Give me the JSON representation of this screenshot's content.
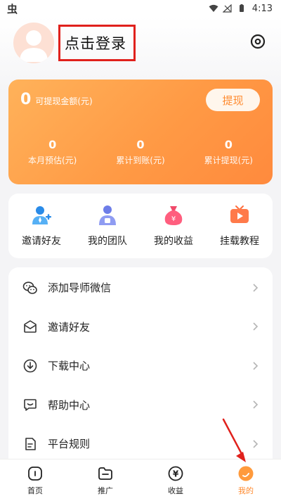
{
  "status_bar": {
    "left_glyph": "虫",
    "time": "4:13"
  },
  "header": {
    "login_text": "点击登录"
  },
  "earnings": {
    "value": "0",
    "label": "可提现金额(元)",
    "withdraw_label": "提现",
    "stats": [
      {
        "value": "0",
        "label": "本月预估(元)"
      },
      {
        "value": "0",
        "label": "累计到账(元)"
      },
      {
        "value": "0",
        "label": "累计提现(元)"
      }
    ]
  },
  "quick_actions": [
    {
      "label": "邀请好友",
      "icon": "invite-user-icon"
    },
    {
      "label": "我的团队",
      "icon": "team-icon"
    },
    {
      "label": "我的收益",
      "icon": "money-bag-icon"
    },
    {
      "label": "挂载教程",
      "icon": "tv-play-icon"
    }
  ],
  "menu": [
    {
      "label": "添加导师微信",
      "icon": "wechat-icon"
    },
    {
      "label": "邀请好友",
      "icon": "envelope-icon"
    },
    {
      "label": "下载中心",
      "icon": "download-icon"
    },
    {
      "label": "帮助中心",
      "icon": "chat-icon"
    },
    {
      "label": "平台规则",
      "icon": "document-icon"
    }
  ],
  "tabs": [
    {
      "label": "首页",
      "icon": "home-icon"
    },
    {
      "label": "推广",
      "icon": "folder-icon"
    },
    {
      "label": "收益",
      "icon": "yen-coin-icon"
    },
    {
      "label": "我的",
      "icon": "profile-icon"
    }
  ],
  "colors": {
    "accent": "#ff8a2e",
    "annotation": "#e0211c"
  }
}
